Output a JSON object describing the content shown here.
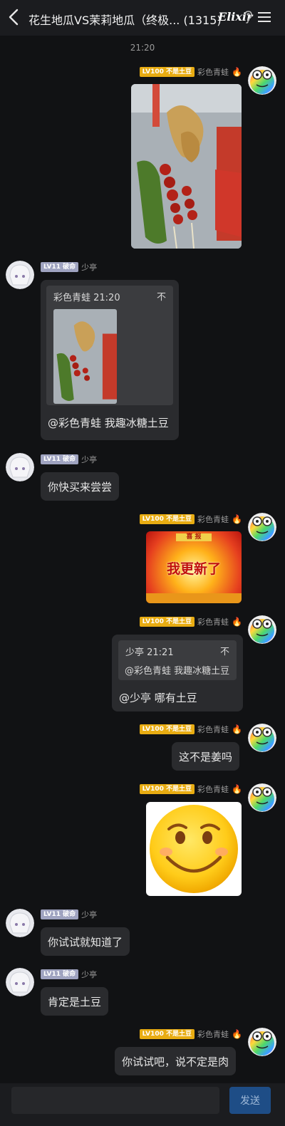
{
  "header": {
    "title": "花生地瓜VS茉莉地瓜（终极... (1315)",
    "brand": "Elixir"
  },
  "chat": {
    "timestamp": "21:20",
    "users": {
      "me": {
        "level": "LV100",
        "title": "不是土豆",
        "name": "彩色青蛙"
      },
      "other": {
        "level": "LV11",
        "title": "破命",
        "name": "少亭"
      }
    },
    "messages": [
      {
        "from": "me",
        "type": "image",
        "image": "candied-fruit-skewers"
      },
      {
        "from": "other",
        "type": "quote",
        "quote_header": "彩色青蛙 21:20",
        "quote_icon": "不",
        "text": "@彩色青蛙 我趣冰糖土豆"
      },
      {
        "from": "other",
        "type": "text",
        "text": "你快买来尝尝"
      },
      {
        "from": "me",
        "type": "image",
        "image": "update-banner",
        "top_label": "喜 报",
        "banner_text": "我更新了"
      },
      {
        "from": "me",
        "type": "quote",
        "quote_header": "少亭 21:21",
        "quote_icon": "不",
        "quote_text": "@彩色青蛙 我趣冰糖土豆",
        "text": "@少亭 哪有土豆"
      },
      {
        "from": "me",
        "type": "text",
        "text": "这不是姜吗"
      },
      {
        "from": "me",
        "type": "image",
        "image": "smiley-sticker"
      },
      {
        "from": "other",
        "type": "text",
        "text": "你试试就知道了"
      },
      {
        "from": "other",
        "type": "text",
        "text": "肯定是土豆"
      },
      {
        "from": "me",
        "type": "text",
        "text": "你试试吧，说不定是肉"
      }
    ]
  },
  "footer": {
    "input_placeholder": "",
    "send_label": "发送"
  },
  "colors": {
    "background": "#111214",
    "bubble": "#2a2b2e",
    "gold_badge": "#e8ac12",
    "gray_badge": "#9fa3c0",
    "send_button": "#1e4d86"
  }
}
